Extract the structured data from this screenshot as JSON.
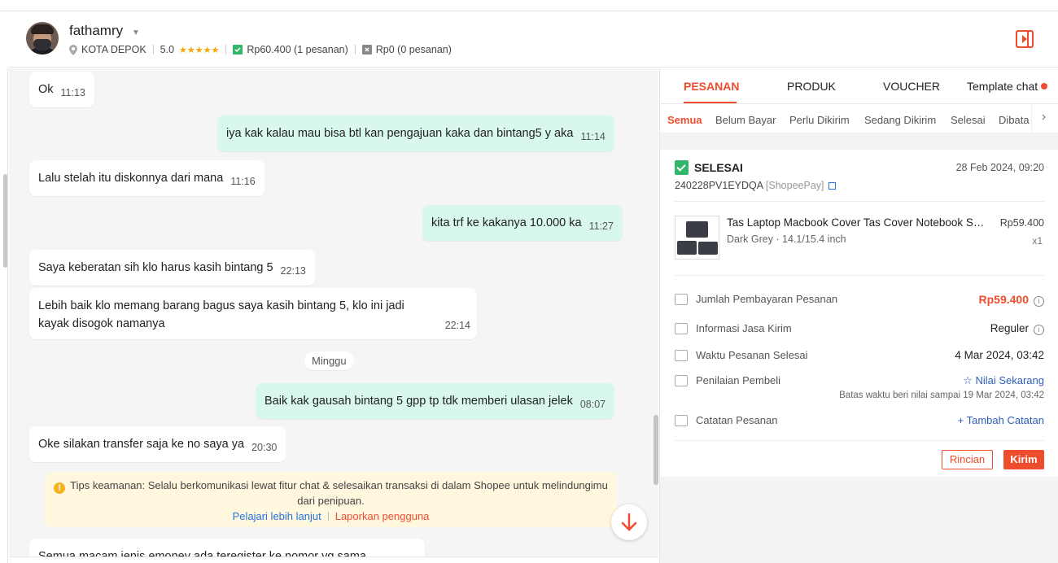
{
  "user": {
    "name": "fathamry",
    "location": "KOTA DEPOK",
    "rating": "5.0",
    "stars": "★★★★★",
    "paid_stat": "Rp60.400 (1 pesanan)",
    "cancel_stat": "Rp0 (0 pesanan)"
  },
  "chat": {
    "messages": [
      {
        "text": "Ok",
        "time": "11:13"
      },
      {
        "text": "iya kak kalau mau bisa btl kan pengajuan kaka dan bintang5 y aka",
        "time": "11:14"
      },
      {
        "text": "Lalu stelah itu diskonnya dari mana",
        "time": "11:16"
      },
      {
        "text": "kita trf ke kakanya 10.000 ka",
        "time": "11:27"
      },
      {
        "text": "Saya keberatan sih klo harus kasih bintang 5",
        "time": "22:13"
      },
      {
        "text": "Lebih baik klo memang barang bagus saya kasih bintang 5, klo ini jadi kayak disogok namanya",
        "time": "22:14"
      },
      {
        "text": "Baik kak gausah bintang 5 gpp tp tdk memberi ulasan jelek",
        "time": "08:07"
      },
      {
        "text": "Oke silakan transfer saja ke no saya ya",
        "time": "20:30"
      },
      {
        "text": "Semua macam jenis emoney ada teregister ke nomor yg sama",
        "time": ""
      }
    ],
    "day_separator": "Minggu",
    "tips": {
      "icon": "!",
      "text": "Tips keamanan: Selalu berkomunikasi lewat fitur chat & selesaikan transaksi di dalam Shopee untuk melindungimu dari penipuan.",
      "learn_more": "Pelajari lebih lanjut",
      "report": "Laporkan pengguna"
    }
  },
  "panel": {
    "tabs": [
      "PESANAN",
      "PRODUK",
      "VOUCHER",
      "Template chat"
    ],
    "subtabs": [
      "Semua",
      "Belum Bayar",
      "Perlu Dikirim",
      "Sedang Dikirim",
      "Selesai",
      "Dibata"
    ],
    "subtab_more": "›",
    "order": {
      "status": "SELESAI",
      "date": "28 Feb 2024, 09:20",
      "id": "240228PV1EYDQA",
      "payment": "[ShopeePay]",
      "product": {
        "name": "Tas Laptop Macbook Cover Tas Cover Notebook Softcase Sleeve",
        "variant": "Dark Grey · 14.1/15.4 inch",
        "price": "Rp59.400",
        "qty": "x1"
      },
      "rows": {
        "payment_label": "Jumlah Pembayaran Pesanan",
        "payment_value": "Rp59.400",
        "shipping_label": "Informasi Jasa Kirim",
        "shipping_value": "Reguler",
        "completed_label": "Waktu Pesanan Selesai",
        "completed_value": "4 Mar 2024, 03:42",
        "rating_label": "Penilaian Pembeli",
        "rating_value": "☆ Nilai Sekarang",
        "rating_note": "Batas waktu beri nilai sampai 19 Mar 2024, 03:42",
        "note_label": "Catatan Pesanan",
        "note_value": "+ Tambah Catatan",
        "info_icon": "i"
      },
      "buttons": {
        "detail": "Rincian",
        "send": "Kirim"
      }
    }
  },
  "colors": {
    "accent": "#ee4d2d",
    "outgoing_bubble": "#d7f7ef",
    "chat_bg": "#f5f5f5",
    "tips_bg": "#fff7de",
    "success": "#32b66a",
    "link": "#2673dd"
  }
}
